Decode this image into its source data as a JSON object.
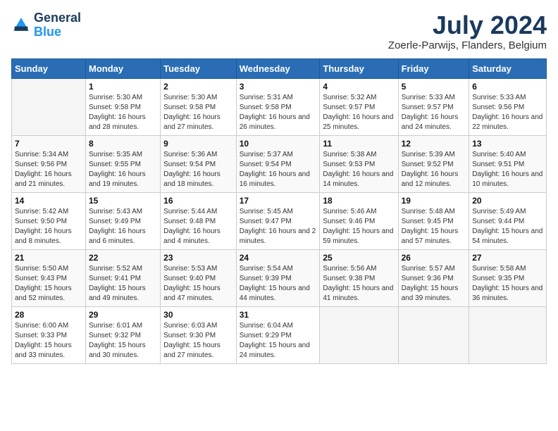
{
  "logo": {
    "line1": "General",
    "line2": "Blue"
  },
  "title": "July 2024",
  "subtitle": "Zoerle-Parwijs, Flanders, Belgium",
  "days_of_week": [
    "Sunday",
    "Monday",
    "Tuesday",
    "Wednesday",
    "Thursday",
    "Friday",
    "Saturday"
  ],
  "weeks": [
    [
      {
        "day": "",
        "sunrise": "",
        "sunset": "",
        "daylight": "",
        "empty": true
      },
      {
        "day": "1",
        "sunrise": "Sunrise: 5:30 AM",
        "sunset": "Sunset: 9:58 PM",
        "daylight": "Daylight: 16 hours and 28 minutes."
      },
      {
        "day": "2",
        "sunrise": "Sunrise: 5:30 AM",
        "sunset": "Sunset: 9:58 PM",
        "daylight": "Daylight: 16 hours and 27 minutes."
      },
      {
        "day": "3",
        "sunrise": "Sunrise: 5:31 AM",
        "sunset": "Sunset: 9:58 PM",
        "daylight": "Daylight: 16 hours and 26 minutes."
      },
      {
        "day": "4",
        "sunrise": "Sunrise: 5:32 AM",
        "sunset": "Sunset: 9:57 PM",
        "daylight": "Daylight: 16 hours and 25 minutes."
      },
      {
        "day": "5",
        "sunrise": "Sunrise: 5:33 AM",
        "sunset": "Sunset: 9:57 PM",
        "daylight": "Daylight: 16 hours and 24 minutes."
      },
      {
        "day": "6",
        "sunrise": "Sunrise: 5:33 AM",
        "sunset": "Sunset: 9:56 PM",
        "daylight": "Daylight: 16 hours and 22 minutes."
      }
    ],
    [
      {
        "day": "7",
        "sunrise": "Sunrise: 5:34 AM",
        "sunset": "Sunset: 9:56 PM",
        "daylight": "Daylight: 16 hours and 21 minutes."
      },
      {
        "day": "8",
        "sunrise": "Sunrise: 5:35 AM",
        "sunset": "Sunset: 9:55 PM",
        "daylight": "Daylight: 16 hours and 19 minutes."
      },
      {
        "day": "9",
        "sunrise": "Sunrise: 5:36 AM",
        "sunset": "Sunset: 9:54 PM",
        "daylight": "Daylight: 16 hours and 18 minutes."
      },
      {
        "day": "10",
        "sunrise": "Sunrise: 5:37 AM",
        "sunset": "Sunset: 9:54 PM",
        "daylight": "Daylight: 16 hours and 16 minutes."
      },
      {
        "day": "11",
        "sunrise": "Sunrise: 5:38 AM",
        "sunset": "Sunset: 9:53 PM",
        "daylight": "Daylight: 16 hours and 14 minutes."
      },
      {
        "day": "12",
        "sunrise": "Sunrise: 5:39 AM",
        "sunset": "Sunset: 9:52 PM",
        "daylight": "Daylight: 16 hours and 12 minutes."
      },
      {
        "day": "13",
        "sunrise": "Sunrise: 5:40 AM",
        "sunset": "Sunset: 9:51 PM",
        "daylight": "Daylight: 16 hours and 10 minutes."
      }
    ],
    [
      {
        "day": "14",
        "sunrise": "Sunrise: 5:42 AM",
        "sunset": "Sunset: 9:50 PM",
        "daylight": "Daylight: 16 hours and 8 minutes."
      },
      {
        "day": "15",
        "sunrise": "Sunrise: 5:43 AM",
        "sunset": "Sunset: 9:49 PM",
        "daylight": "Daylight: 16 hours and 6 minutes."
      },
      {
        "day": "16",
        "sunrise": "Sunrise: 5:44 AM",
        "sunset": "Sunset: 9:48 PM",
        "daylight": "Daylight: 16 hours and 4 minutes."
      },
      {
        "day": "17",
        "sunrise": "Sunrise: 5:45 AM",
        "sunset": "Sunset: 9:47 PM",
        "daylight": "Daylight: 16 hours and 2 minutes."
      },
      {
        "day": "18",
        "sunrise": "Sunrise: 5:46 AM",
        "sunset": "Sunset: 9:46 PM",
        "daylight": "Daylight: 15 hours and 59 minutes."
      },
      {
        "day": "19",
        "sunrise": "Sunrise: 5:48 AM",
        "sunset": "Sunset: 9:45 PM",
        "daylight": "Daylight: 15 hours and 57 minutes."
      },
      {
        "day": "20",
        "sunrise": "Sunrise: 5:49 AM",
        "sunset": "Sunset: 9:44 PM",
        "daylight": "Daylight: 15 hours and 54 minutes."
      }
    ],
    [
      {
        "day": "21",
        "sunrise": "Sunrise: 5:50 AM",
        "sunset": "Sunset: 9:43 PM",
        "daylight": "Daylight: 15 hours and 52 minutes."
      },
      {
        "day": "22",
        "sunrise": "Sunrise: 5:52 AM",
        "sunset": "Sunset: 9:41 PM",
        "daylight": "Daylight: 15 hours and 49 minutes."
      },
      {
        "day": "23",
        "sunrise": "Sunrise: 5:53 AM",
        "sunset": "Sunset: 9:40 PM",
        "daylight": "Daylight: 15 hours and 47 minutes."
      },
      {
        "day": "24",
        "sunrise": "Sunrise: 5:54 AM",
        "sunset": "Sunset: 9:39 PM",
        "daylight": "Daylight: 15 hours and 44 minutes."
      },
      {
        "day": "25",
        "sunrise": "Sunrise: 5:56 AM",
        "sunset": "Sunset: 9:38 PM",
        "daylight": "Daylight: 15 hours and 41 minutes."
      },
      {
        "day": "26",
        "sunrise": "Sunrise: 5:57 AM",
        "sunset": "Sunset: 9:36 PM",
        "daylight": "Daylight: 15 hours and 39 minutes."
      },
      {
        "day": "27",
        "sunrise": "Sunrise: 5:58 AM",
        "sunset": "Sunset: 9:35 PM",
        "daylight": "Daylight: 15 hours and 36 minutes."
      }
    ],
    [
      {
        "day": "28",
        "sunrise": "Sunrise: 6:00 AM",
        "sunset": "Sunset: 9:33 PM",
        "daylight": "Daylight: 15 hours and 33 minutes."
      },
      {
        "day": "29",
        "sunrise": "Sunrise: 6:01 AM",
        "sunset": "Sunset: 9:32 PM",
        "daylight": "Daylight: 15 hours and 30 minutes."
      },
      {
        "day": "30",
        "sunrise": "Sunrise: 6:03 AM",
        "sunset": "Sunset: 9:30 PM",
        "daylight": "Daylight: 15 hours and 27 minutes."
      },
      {
        "day": "31",
        "sunrise": "Sunrise: 6:04 AM",
        "sunset": "Sunset: 9:29 PM",
        "daylight": "Daylight: 15 hours and 24 minutes."
      },
      {
        "day": "",
        "sunrise": "",
        "sunset": "",
        "daylight": "",
        "empty": true
      },
      {
        "day": "",
        "sunrise": "",
        "sunset": "",
        "daylight": "",
        "empty": true
      },
      {
        "day": "",
        "sunrise": "",
        "sunset": "",
        "daylight": "",
        "empty": true
      }
    ]
  ]
}
